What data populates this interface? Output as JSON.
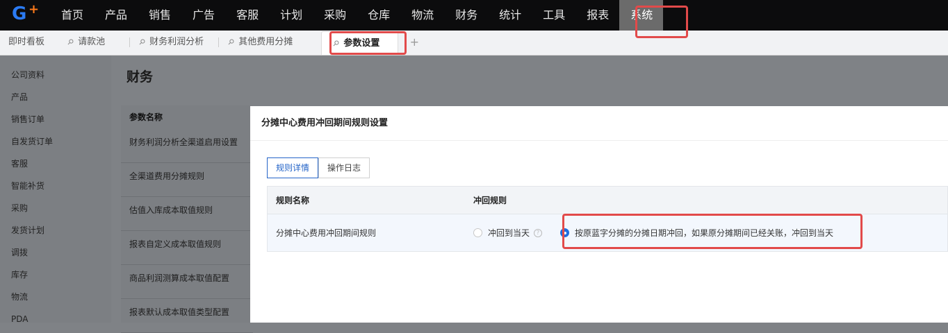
{
  "logo": {
    "letter": "G",
    "plus": "+"
  },
  "top_menu": [
    "首页",
    "产品",
    "销售",
    "广告",
    "客服",
    "计划",
    "采购",
    "仓库",
    "物流",
    "财务",
    "统计",
    "工具",
    "报表",
    "系统"
  ],
  "top_menu_active": "系统",
  "tabs": {
    "dashboard": "即时看板",
    "items": [
      "请款池",
      "财务利润分析",
      "其他费用分摊"
    ],
    "active": "参数设置",
    "add": "+"
  },
  "sidebar": [
    "公司资料",
    "产品",
    "销售订单",
    "自发货订单",
    "客服",
    "智能补货",
    "采购",
    "发货计划",
    "调拨",
    "库存",
    "物流",
    "PDA"
  ],
  "page_title": "财务",
  "param_panel": {
    "header": "参数名称",
    "rows": [
      "财务利润分析全渠道启用设置",
      "全渠道费用分摊规则",
      "估值入库成本取值规则",
      "报表自定义成本取值规则",
      "商品利润测算成本取值配置",
      "报表默认成本取值类型配置"
    ]
  },
  "modal": {
    "title": "分摊中心费用冲回期间规则设置",
    "subtabs": [
      "规则详情",
      "操作日志"
    ],
    "table": {
      "headers": [
        "规则名称",
        "冲回规则"
      ],
      "row": {
        "name": "分摊中心费用冲回期间规则",
        "option1": "冲回到当天",
        "option2": "按原蓝字分摊的分摊日期冲回，如果原分摊期间已经关账，冲回到当天",
        "selected": "option2"
      }
    }
  },
  "colors": {
    "accent": "#1f6fe0",
    "highlight": "#e24a4a",
    "topbar": "#0c0c0d"
  }
}
